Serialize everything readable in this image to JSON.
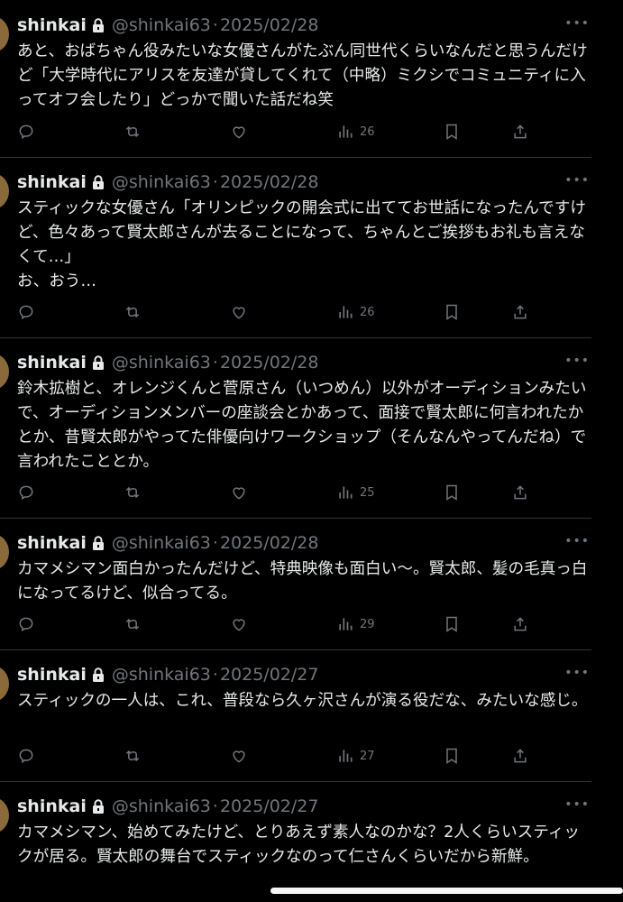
{
  "tweets": [
    {
      "name": "shinkai",
      "handle": "@shinkai63",
      "date": "2025/02/28",
      "text": "あと、おばちゃん役みたいな女優さんがたぶん同世代くらいなんだと思うんだけど「大学時代にアリスを友達が貸してくれて（中略）ミクシでコミュニティに入ってオフ会したり」どっかで聞いた話だね笑",
      "views": "26"
    },
    {
      "name": "shinkai",
      "handle": "@shinkai63",
      "date": "2025/02/28",
      "text": "スティックな女優さん「オリンピックの開会式に出ててお世話になったんですけど、色々あって賢太郎さんが去ることになって、ちゃんとご挨拶もお礼も言えなくて…」\nお、おう…",
      "views": "26"
    },
    {
      "name": "shinkai",
      "handle": "@shinkai63",
      "date": "2025/02/28",
      "text": "鈴木拡樹と、オレンジくんと菅原さん（いつめん）以外がオーディションみたいで、オーディションメンバーの座談会とかあって、面接で賢太郎に何言われたかとか、昔賢太郎がやってた俳優向けワークショップ（そんなんやってんだね）で言われたこととか。",
      "views": "25"
    },
    {
      "name": "shinkai",
      "handle": "@shinkai63",
      "date": "2025/02/28",
      "text": "カマメシマン面白かったんだけど、特典映像も面白い〜。賢太郎、髪の毛真っ白になってるけど、似合ってる。",
      "views": "29"
    },
    {
      "name": "shinkai",
      "handle": "@shinkai63",
      "date": "2025/02/27",
      "text": "スティックの一人は、これ、普段なら久ヶ沢さんが演る役だな、みたいな感じ。",
      "views": "27"
    },
    {
      "name": "shinkai",
      "handle": "@shinkai63",
      "date": "2025/02/27",
      "text": "カマメシマン、始めてみたけど、とりあえず素人なのかな？2人くらいスティックが居る。賢太郎の舞台でスティックなのって仁さんくらいだから新鮮。",
      "views": ""
    }
  ],
  "ui": {
    "separator": "·",
    "more": "•••"
  },
  "colors": {
    "background": "#000000",
    "text": "#e7e9ea",
    "muted": "#71767b",
    "border": "#2f3336"
  }
}
